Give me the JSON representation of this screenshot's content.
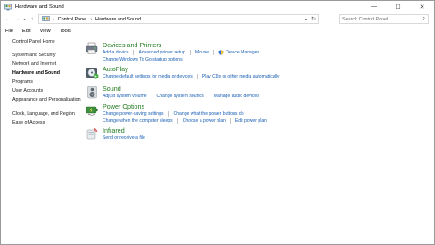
{
  "window": {
    "title": "Hardware and Sound",
    "controls": {
      "minimize": "—",
      "maximize": "☐",
      "close": "✕"
    }
  },
  "address": {
    "breadcrumbs": [
      "Control Panel",
      "Hardware and Sound"
    ],
    "search_placeholder": "Search Control Panel"
  },
  "menu": [
    "File",
    "Edit",
    "View",
    "Tools"
  ],
  "sidebar": {
    "home": "Control Panel Home",
    "items": [
      "System and Security",
      "Network and Internet",
      "Hardware and Sound",
      "Programs",
      "User Accounts",
      "Appearance and Personalization",
      "Clock, Language, and Region",
      "Ease of Access"
    ]
  },
  "categories": [
    {
      "title": "Devices and Printers",
      "icon": "printer-icon",
      "rows": [
        [
          "Add a device",
          "Advanced printer setup",
          "Mouse",
          "Device Manager"
        ],
        [
          "Change Windows To Go startup options"
        ]
      ]
    },
    {
      "title": "AutoPlay",
      "icon": "autoplay-icon",
      "rows": [
        [
          "Change default settings for media or devices",
          "Play CDs or other media automatically"
        ]
      ]
    },
    {
      "title": "Sound",
      "icon": "speaker-icon",
      "rows": [
        [
          "Adjust system volume",
          "Change system sounds",
          "Manage audio devices"
        ]
      ]
    },
    {
      "title": "Power Options",
      "icon": "power-options-icon",
      "rows": [
        [
          "Change power-saving settings",
          "Change what the power buttons do"
        ],
        [
          "Change when the computer sleeps",
          "Choose a power plan",
          "Edit power plan"
        ]
      ]
    },
    {
      "title": "Infrared",
      "icon": "infrared-icon",
      "rows": [
        [
          "Send or receive a file"
        ]
      ]
    }
  ]
}
